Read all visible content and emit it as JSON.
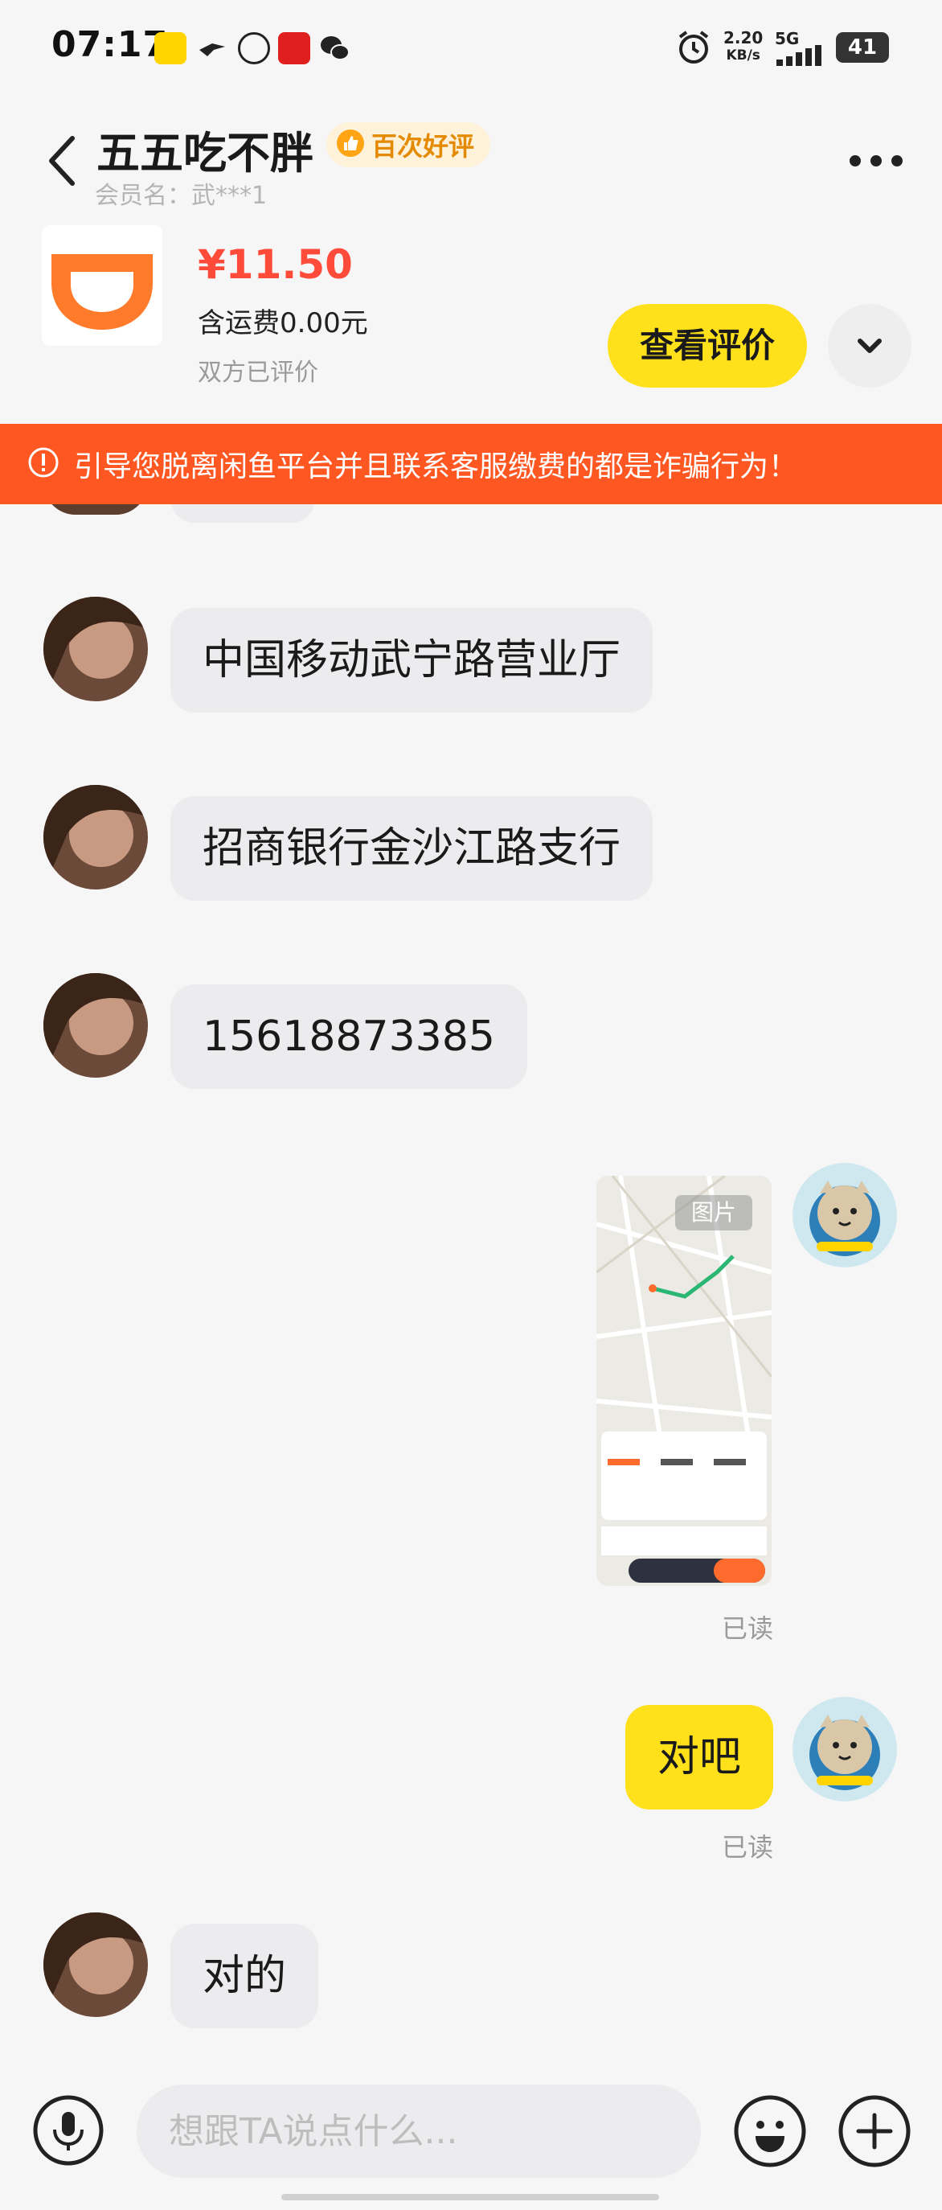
{
  "status_bar": {
    "time": "07:17",
    "network_speed": "2.20",
    "network_unit": "KB/s",
    "network_type": "5G",
    "battery": "41"
  },
  "header": {
    "seller_name": "五五吃不胖",
    "badge": "百次好评",
    "member_label": "会员名：武***1"
  },
  "product": {
    "price": "¥11.50",
    "shipping": "含运费0.00元",
    "review_status": "双方已评价",
    "view_review_label": "查看评价"
  },
  "warning": {
    "text": "引导您脱离闲鱼平台并且联系客服缴费的都是诈骗行为！"
  },
  "messages": [
    {
      "side": "left",
      "text": "中国移动武宁路营业厅"
    },
    {
      "side": "left",
      "text": "招商银行金沙江路支行"
    },
    {
      "side": "left",
      "text": "15618873385"
    },
    {
      "side": "right",
      "type": "image",
      "image_tag": "图片",
      "read": "已读"
    },
    {
      "side": "right",
      "text": "对吧",
      "read": "已读"
    },
    {
      "side": "left",
      "text": "对的"
    }
  ],
  "input": {
    "placeholder": "想跟TA说点什么..."
  },
  "colors": {
    "accent_yellow": "#ffe11b",
    "price_red": "#ff4b3a",
    "warning_orange": "#ff5722",
    "badge_orange": "#e48a00"
  }
}
